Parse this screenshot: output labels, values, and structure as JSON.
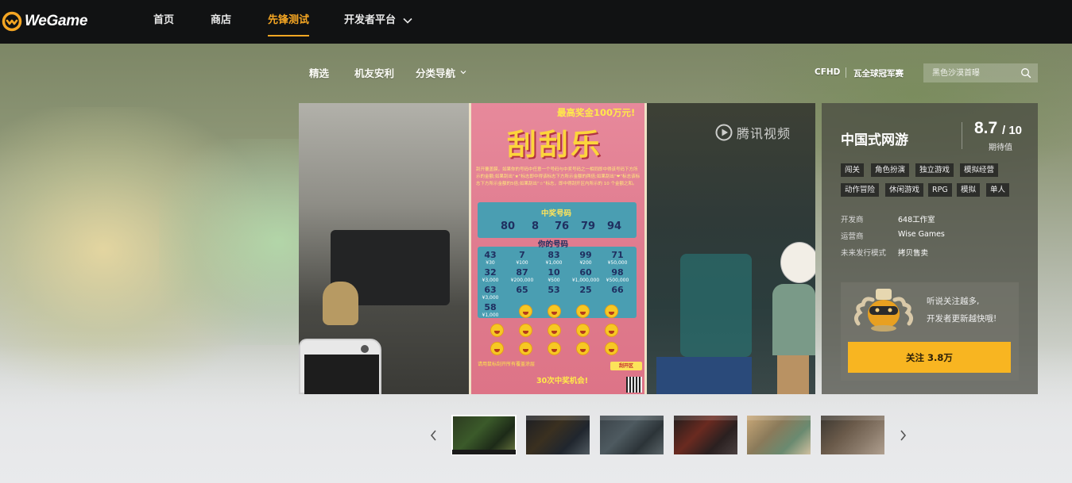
{
  "brand": {
    "name": "WeGame"
  },
  "nav": {
    "items": [
      {
        "label": "首页",
        "active": false
      },
      {
        "label": "商店",
        "active": false
      },
      {
        "label": "先锋测试",
        "active": true
      },
      {
        "label": "开发者平台",
        "active": false
      }
    ],
    "accent_color": "#f5a623"
  },
  "subnav": {
    "items": [
      "精选",
      "机友安利",
      "分类导航"
    ],
    "right_links": [
      "CFHD",
      "瓦全球冠军赛"
    ],
    "search_placeholder": "黑色沙漠首曝"
  },
  "video": {
    "watermark": "腾讯视频",
    "ticket": {
      "top_prize": "最高奖金100万元!",
      "title": "刮刮乐",
      "rules": "刮开覆盖膜，如果你的号码中任意一个号码与中奖号码之一相同即中得该号码下方所示的金额;如果刮出“★”标志即中得该标志下方所示金额的两倍;如果刮出“❤”标志该标志下方所示金额的5倍;如果刮出“☆”标志，即中得刮开区内所示的 10 个金额之和。",
      "winning_label": "中奖号码",
      "winning_numbers": [
        "80",
        "8",
        "76",
        "79",
        "94"
      ],
      "your_label": "你的号码",
      "your_numbers": [
        {
          "n": "43",
          "p": "¥30"
        },
        {
          "n": "7",
          "p": "¥100"
        },
        {
          "n": "83",
          "p": "¥1,000"
        },
        {
          "n": "99",
          "p": "¥200"
        },
        {
          "n": "71",
          "p": "¥50,000"
        },
        {
          "n": "32",
          "p": "¥3,000"
        },
        {
          "n": "87",
          "p": "¥200,000"
        },
        {
          "n": "10",
          "p": "¥500"
        },
        {
          "n": "60",
          "p": "¥1,000,000"
        },
        {
          "n": "98",
          "p": "¥500,000"
        },
        {
          "n": "63",
          "p": "¥3,000"
        },
        {
          "n": "65",
          "p": ""
        },
        {
          "n": "53",
          "p": ""
        },
        {
          "n": "25",
          "p": ""
        },
        {
          "n": "66",
          "p": ""
        },
        {
          "n": "58",
          "p": "¥1,000"
        }
      ],
      "footer_note": "请用鼠标刮开所有覆盖涂层",
      "scratch_btn": "刮开区",
      "footer_title": "30次中奖机会!"
    }
  },
  "game": {
    "title": "中国式网游",
    "score": "8.7",
    "score_max": "/ 10",
    "score_label": "期待值",
    "tags": [
      "闯关",
      "角色扮演",
      "独立游戏",
      "模拟经营",
      "动作冒险",
      "休闲游戏",
      "RPG",
      "模拟",
      "单人"
    ],
    "meta": [
      {
        "label": "开发商",
        "value": "648工作室"
      },
      {
        "label": "运营商",
        "value": "Wise Games"
      },
      {
        "label": "未来发行模式",
        "value": "拷贝售卖"
      }
    ],
    "follow": {
      "line1": "听说关注越多,",
      "line2": "开发者更新越快哦!",
      "button": "关注 3.8万",
      "button_color": "#f8b521"
    }
  },
  "thumbnails": {
    "count": 6,
    "active_index": 0
  }
}
